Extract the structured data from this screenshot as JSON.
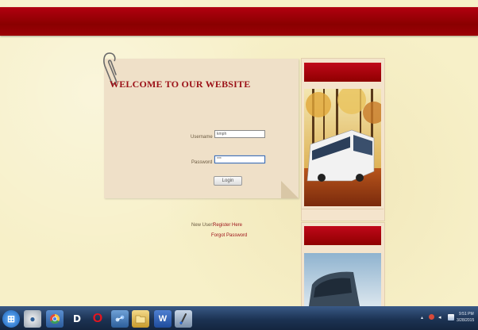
{
  "header": {
    "color": "#9c0006"
  },
  "login": {
    "title": "WELCOME TO OUR WEBSITE",
    "username_label": "Username",
    "username_value": "kmph",
    "password_label": "Password",
    "password_value": "***",
    "login_button": "Login",
    "new_user_text": "New User:",
    "register_link": "Register Here",
    "forgot_link": "Forgot Password"
  },
  "sidebar": {
    "panel_1_image": "bus-in-autumn-forest",
    "panel_2_image": "bus-front-sky"
  },
  "taskbar": {
    "icons": [
      "windows-start-icon",
      "chrome-icon",
      "chrome-icon-2",
      "d-app-icon",
      "opera-icon",
      "network-app-icon",
      "folder-icon",
      "word-icon",
      "paint-icon"
    ],
    "clock_time": "9:51 PM",
    "clock_date": "3/28/2015"
  }
}
